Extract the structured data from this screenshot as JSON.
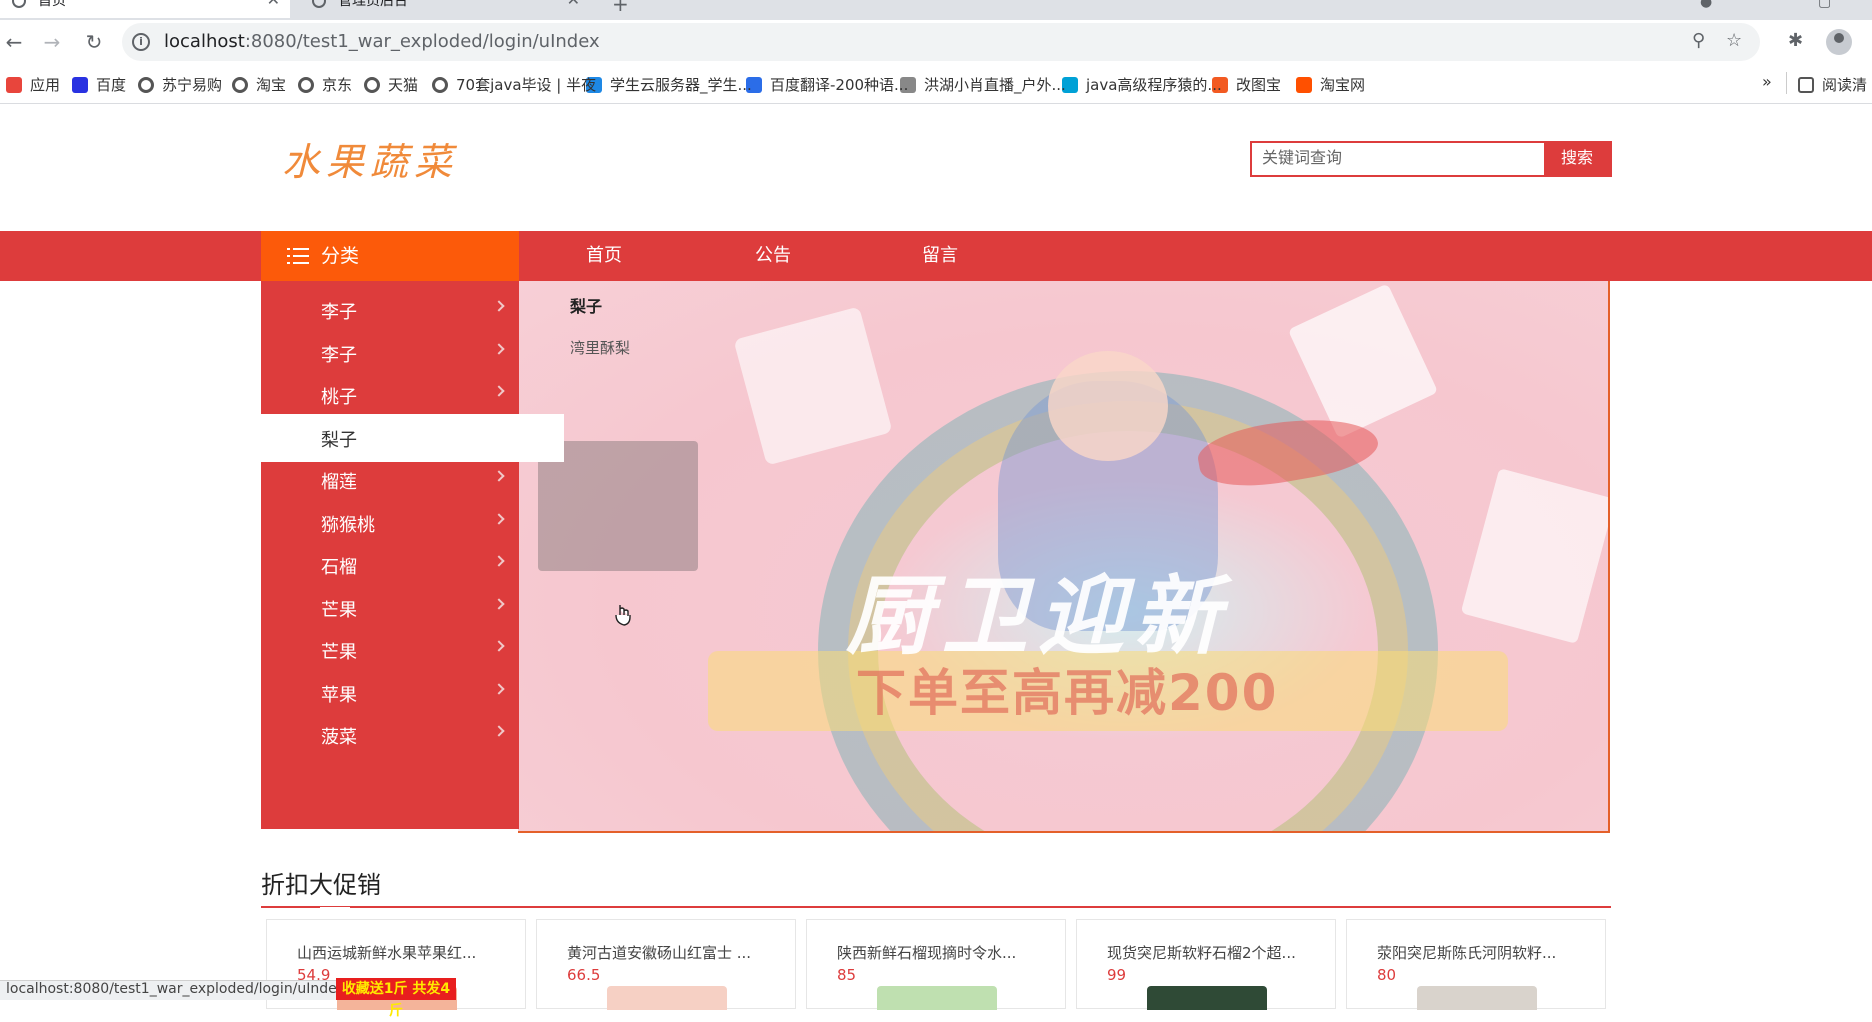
{
  "browser": {
    "tabs": [
      {
        "title": "首页",
        "active": true
      },
      {
        "title": "管理员后台",
        "active": false
      }
    ],
    "url": {
      "host": "localhost",
      "path": ":8080/test1_war_exploded/login/uIndex"
    },
    "bookmarks": [
      {
        "label": "应用",
        "icon": "apps-grid-icon",
        "color": "#e8453c"
      },
      {
        "label": "百度",
        "icon": "baidu-paw-icon",
        "color": "#2932e1"
      },
      {
        "label": "苏宁易购",
        "icon": "globe-icon",
        "color": "#555555"
      },
      {
        "label": "淘宝",
        "icon": "globe-icon",
        "color": "#555555"
      },
      {
        "label": "京东",
        "icon": "globe-icon",
        "color": "#555555"
      },
      {
        "label": "天猫",
        "icon": "globe-icon",
        "color": "#555555"
      },
      {
        "label": "70套java毕设 | 半夜",
        "icon": "globe-icon",
        "color": "#555555"
      },
      {
        "label": "学生云服务器_学生...",
        "icon": "cloud-icon",
        "color": "#1e88e5"
      },
      {
        "label": "百度翻译-200种语...",
        "icon": "translate-icon",
        "color": "#2b6de8"
      },
      {
        "label": "洪湖小肖直播_户外...",
        "icon": "bird-icon",
        "color": "#888888"
      },
      {
        "label": "java高级程序猿的...",
        "icon": "bilibili-icon",
        "color": "#00a1d6"
      },
      {
        "label": "改图宝",
        "icon": "image-edit-icon",
        "color": "#f25a22"
      },
      {
        "label": "淘宝网",
        "icon": "taobao-icon",
        "color": "#ff5000"
      }
    ],
    "bookmarks_more": "»",
    "reading_list": "阅读清"
  },
  "site": {
    "logo": "水果蔬菜",
    "search": {
      "placeholder": "关键词查询",
      "button": "搜索"
    },
    "nav": {
      "category": "分类",
      "links": [
        "首页",
        "公告",
        "留言"
      ]
    },
    "categories": [
      "李子",
      "李子",
      "桃子",
      "梨子",
      "榴莲",
      "猕猴桃",
      "石榴",
      "芒果",
      "芒果",
      "苹果",
      "菠菜"
    ],
    "active_category_index": 3,
    "submenu": {
      "title": "梨子",
      "items": [
        "湾里酥梨"
      ]
    },
    "banner": {
      "title": "厨卫迎新",
      "subtitle": "下单至高再减200"
    },
    "section_title": "折扣大促销",
    "products": [
      {
        "name": "山西运城新鲜水果苹果红...",
        "price": "54.9",
        "thumb_color": "#f4b49a"
      },
      {
        "name": "黄河古道安徽砀山红富士 ...",
        "price": "66.5",
        "thumb_color": "#f6d0c4"
      },
      {
        "name": "陕西新鲜石榴现摘时令水...",
        "price": "85",
        "thumb_color": "#bfe0b0"
      },
      {
        "name": "现货突尼斯软籽石榴2个超...",
        "price": "99",
        "thumb_color": "#2f4a36"
      },
      {
        "name": "荥阳突尼斯陈氏河阴软籽...",
        "price": "80",
        "thumb_color": "#d9d3cc"
      }
    ],
    "promo_tag": "收藏送1斤 共发4斤",
    "status_url": "localhost:8080/test1_war_exploded/login/uIndex"
  },
  "colors": {
    "primary": "#dd3c3c",
    "accent": "#fc5a0a"
  }
}
